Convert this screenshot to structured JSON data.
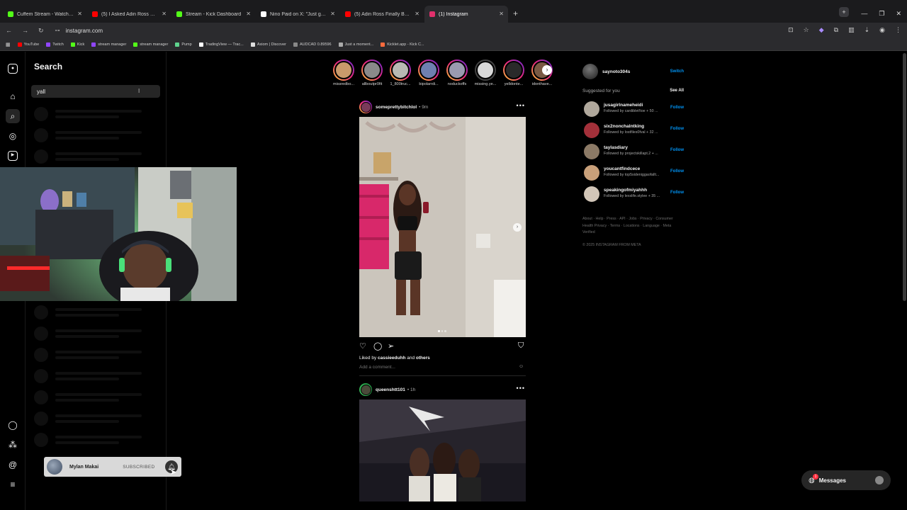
{
  "browser": {
    "tabs": [
      {
        "title": "Cuffem Stream - Watch Live on",
        "color": "#53fc18",
        "active": false
      },
      {
        "title": "(5) I Asked Adin Ross How He I",
        "color": "#ff0000",
        "active": false
      },
      {
        "title": "Stream - Kick Dashboard",
        "color": "#53fc18",
        "active": false
      },
      {
        "title": "Nino Paid on X: \"Just getting w",
        "color": "#ffffff",
        "active": false
      },
      {
        "title": "(5) Adin Ross Finally Brought S",
        "color": "#ff0000",
        "active": false
      },
      {
        "title": "(1) Instagram",
        "color": "#e1306c",
        "active": true
      }
    ],
    "url": "instagram.com",
    "bookmarks": [
      {
        "label": "YouTube",
        "color": "#ff0000"
      },
      {
        "label": "Twitch",
        "color": "#9146ff"
      },
      {
        "label": "Kick",
        "color": "#53fc18"
      },
      {
        "label": "stream manager",
        "color": "#9146ff"
      },
      {
        "label": "stream manager",
        "color": "#53fc18"
      },
      {
        "label": "Pump",
        "color": "#5fd38d"
      },
      {
        "label": "TradingView — Trac...",
        "color": "#ffffff"
      },
      {
        "label": "Axiom | Discover",
        "color": "#dddddd"
      },
      {
        "label": "AUDCAD 0.89596",
        "color": "#888888"
      },
      {
        "label": "Just a moment...",
        "color": "#aaaaaa"
      },
      {
        "label": "Kicklet.app - Kick C...",
        "color": "#ff6b3d"
      }
    ]
  },
  "search": {
    "title": "Search",
    "query": "yall"
  },
  "stories": [
    {
      "name": "missredbo..."
    },
    {
      "name": "allboutpr0fit"
    },
    {
      "name": "1_800truc..."
    },
    {
      "name": "bipolarrdi..."
    },
    {
      "name": "noduckoffs"
    },
    {
      "name": "missing.ye..."
    },
    {
      "name": "yelldonte..."
    },
    {
      "name": "idonthave..."
    }
  ],
  "posts": [
    {
      "username": "someprettybitchlol",
      "time": "• 9m",
      "liked_by": "cassieeduhh",
      "liked_suffix": " and ",
      "others": "others",
      "comment_placeholder": "Add a comment..."
    },
    {
      "username": "queenshtt101",
      "time": "• 1h"
    }
  ],
  "sidebar_right": {
    "username": "saynoto304s",
    "switch_label": "Switch",
    "suggested_title": "Suggested for you",
    "see_all": "See All",
    "suggestions": [
      {
        "username": "jusagirlnameheidi",
        "sub": "Followed by cardiblet!toe + 50 ...",
        "follow": "Follow"
      },
      {
        "username": "six2nonchalntking",
        "sub": "Followed by lostfiles0fval + 32 ...",
        "follow": "Follow"
      },
      {
        "username": "taylasdiary",
        "sub": "Followed by projectskillapt.2 + ...",
        "follow": "Follow"
      },
      {
        "username": "youcantfindcece",
        "sub": "Followed by top5sideniggaofallt...",
        "follow": "Follow"
      },
      {
        "username": "speakingofmiyahhh",
        "sub": "Followed by lexslife.stylee + 35 ...",
        "follow": "Follow"
      }
    ],
    "footer": "About · Help · Press · API · Jobs · Privacy · Consumer Health Privacy · Terms · Locations · Language · Meta Verified",
    "copyright": "© 2025 INSTAGRAM FROM META"
  },
  "overlay": {
    "sub_name": "Mylan Makai",
    "sub_status": "SUBSCRIBED"
  },
  "messages": {
    "label": "Messages",
    "badge": "1"
  }
}
